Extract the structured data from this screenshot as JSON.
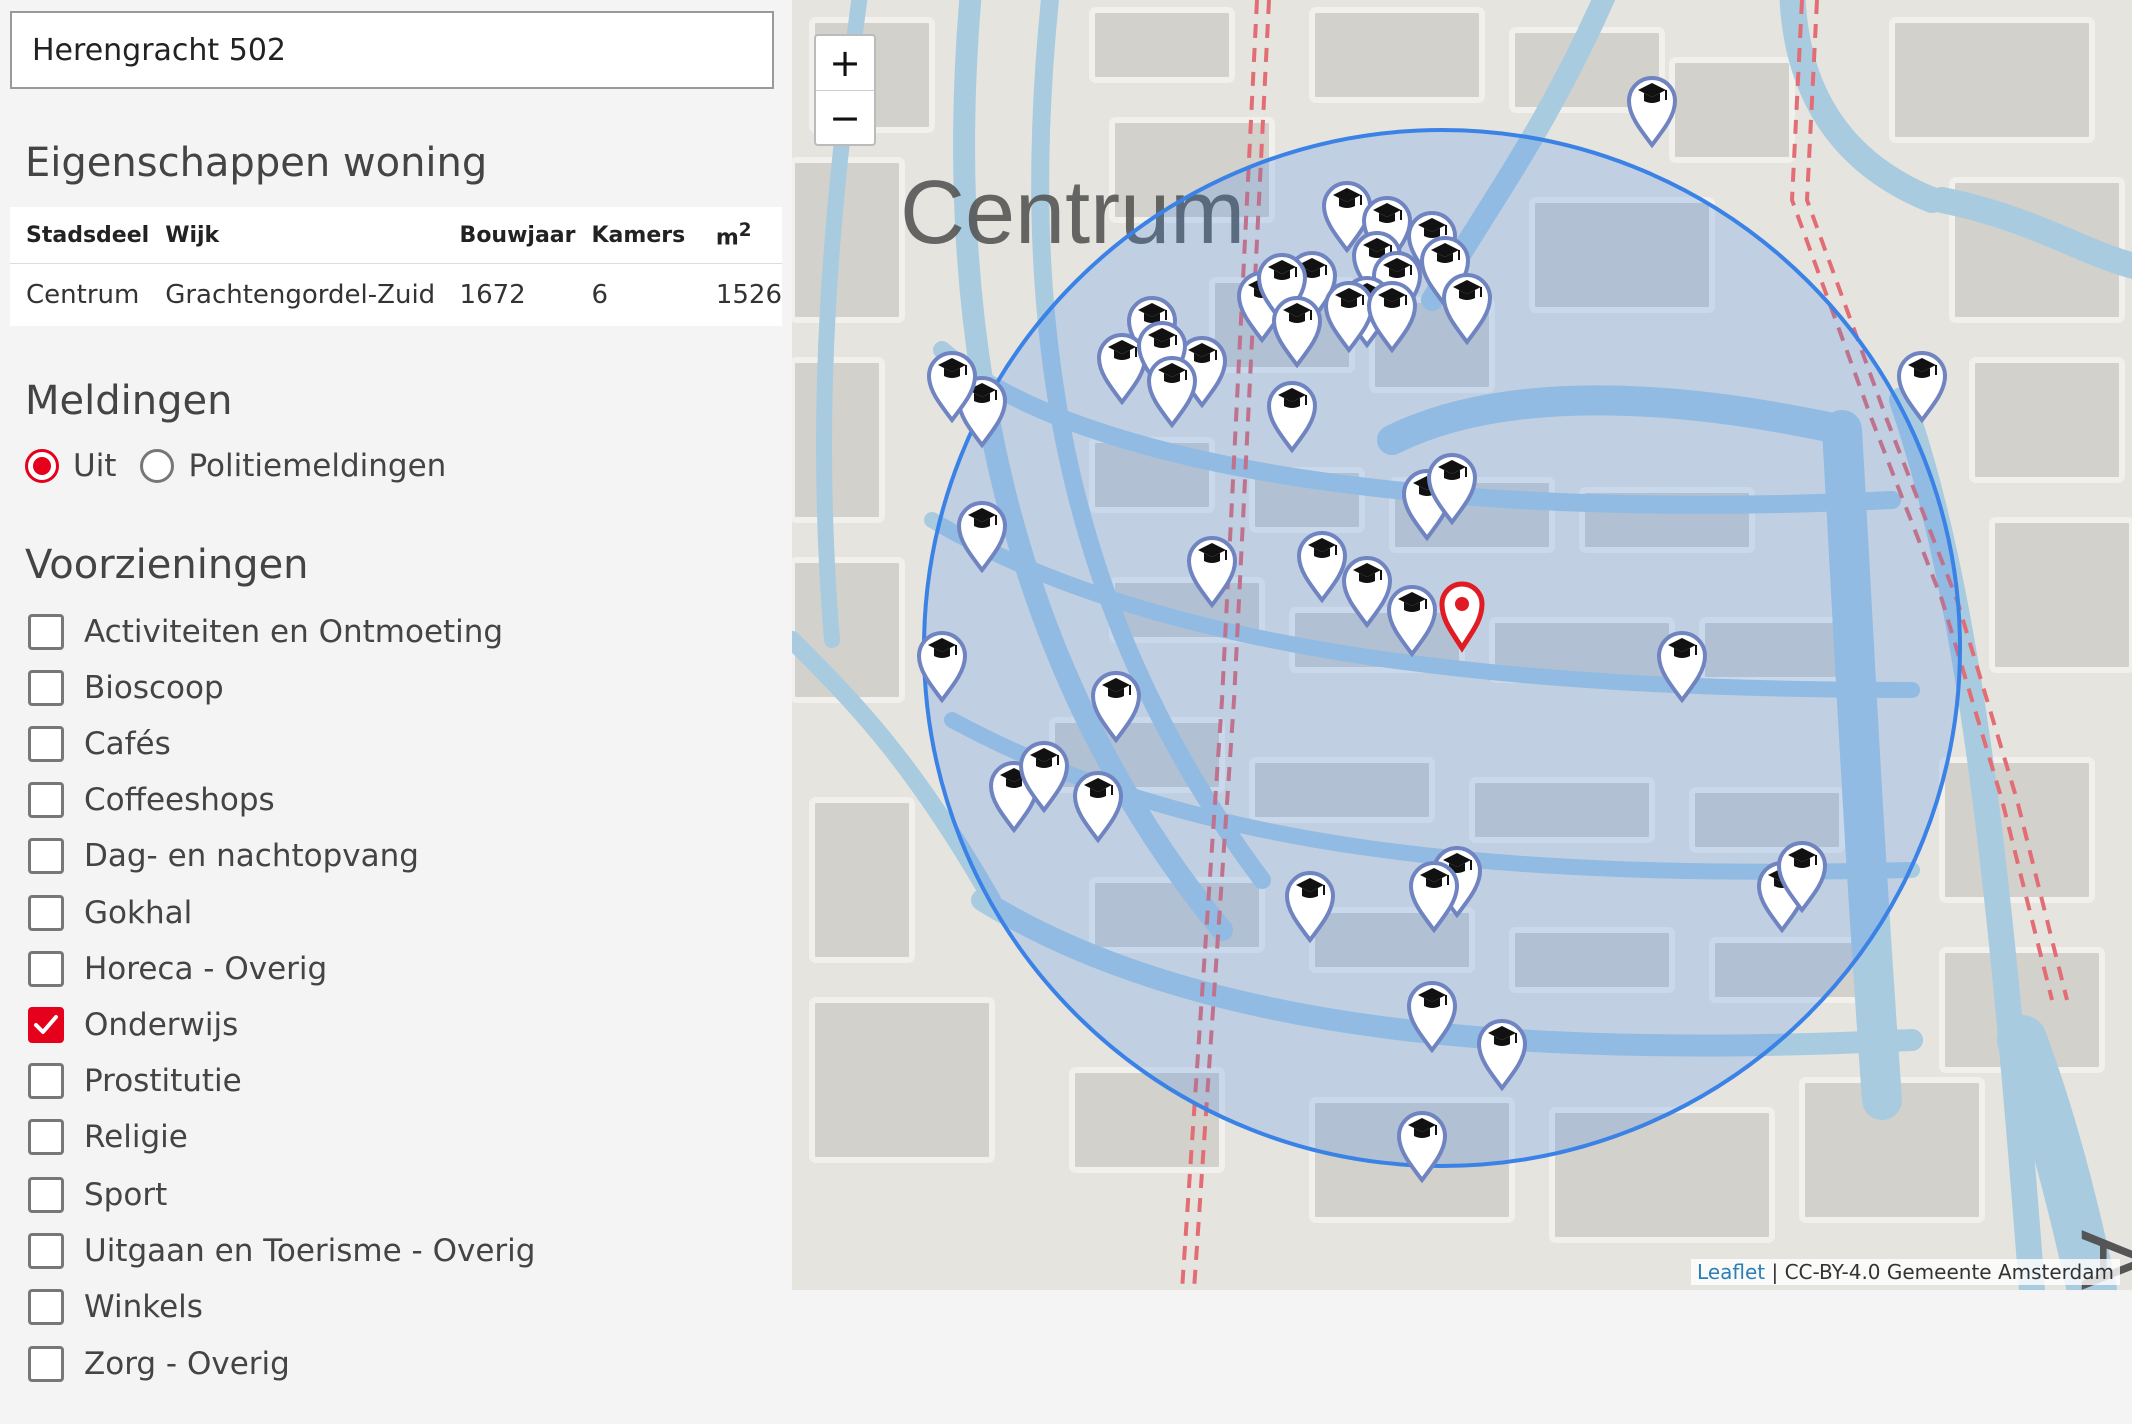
{
  "search": {
    "value": "Herengracht 502"
  },
  "properties": {
    "title": "Eigenschappen woning",
    "headers": {
      "stadsdeel": "Stadsdeel",
      "wijk": "Wijk",
      "bouwjaar": "Bouwjaar",
      "kamers": "Kamers",
      "area_unit": "m",
      "area_sup": "2"
    },
    "row": {
      "stadsdeel": "Centrum",
      "wijk": "Grachtengordel-Zuid",
      "bouwjaar": "1672",
      "kamers": "6",
      "area": "1526"
    }
  },
  "meldingen": {
    "title": "Meldingen",
    "options": [
      {
        "label": "Uit",
        "selected": true
      },
      {
        "label": "Politiemeldingen",
        "selected": false
      }
    ]
  },
  "voorzieningen": {
    "title": "Voorzieningen",
    "items": [
      {
        "label": "Activiteiten en Ontmoeting",
        "checked": false
      },
      {
        "label": "Bioscoop",
        "checked": false
      },
      {
        "label": "Cafés",
        "checked": false
      },
      {
        "label": "Coffeeshops",
        "checked": false
      },
      {
        "label": "Dag- en nachtopvang",
        "checked": false
      },
      {
        "label": "Gokhal",
        "checked": false
      },
      {
        "label": "Horeca - Overig",
        "checked": false
      },
      {
        "label": "Onderwijs",
        "checked": true
      },
      {
        "label": "Prostitutie",
        "checked": false
      },
      {
        "label": "Religie",
        "checked": false
      },
      {
        "label": "Sport",
        "checked": false
      },
      {
        "label": "Uitgaan en Toerisme - Overig",
        "checked": false
      },
      {
        "label": "Winkels",
        "checked": false
      },
      {
        "label": "Zorg - Overig",
        "checked": false
      }
    ]
  },
  "map": {
    "label_district": "Centrum",
    "label_partial": "An",
    "zoom_in": "+",
    "zoom_out": "−",
    "attribution_link": "Leaflet",
    "attribution_text": " | CC-BY-4.0 Gemeente Amsterdam",
    "colors": {
      "water": "#a9cbe0",
      "land": "#e6e4df",
      "block": "#d6d4cf",
      "radius": "#3b82e6",
      "marker": "#6f84c0",
      "home_marker": "#e01b24"
    }
  }
}
